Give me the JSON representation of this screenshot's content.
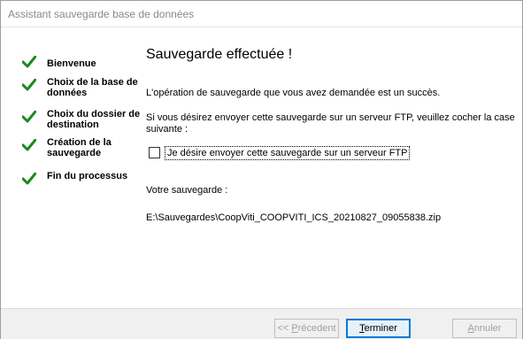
{
  "window": {
    "title": "Assistant sauvegarde base de données"
  },
  "colors": {
    "check_green": "#1a8a1a",
    "accent": "#0078d7"
  },
  "sidebar": {
    "steps": [
      {
        "label": "Bienvenue",
        "icon": "check-icon",
        "completed": true
      },
      {
        "label": "Choix de la base de données",
        "icon": "check-icon",
        "completed": true
      },
      {
        "label": "Choix du dossier de destination",
        "icon": "check-icon",
        "completed": true
      },
      {
        "label": "Création de la sauvegarde",
        "icon": "check-icon",
        "completed": true
      },
      {
        "label": "Fin du processus",
        "icon": "check-icon",
        "completed": true
      }
    ]
  },
  "main": {
    "heading": "Sauvegarde effectuée !",
    "success_message": "L'opération de sauvegarde que vous avez demandée est un succès.",
    "ftp_instruction": "Si vous désirez envoyer cette sauvegarde sur un serveur FTP,  veuillez cocher la case suivante :",
    "ftp_checkbox": {
      "label": "Je désire envoyer cette sauvegarde sur un serveur FTP",
      "checked": false
    },
    "backup_label": "Votre sauvegarde :",
    "backup_path": "E:\\Sauvegardes\\CoopViti_COOPVITI_ICS_20210827_09055838.zip"
  },
  "footer": {
    "previous": {
      "prefix": "<< ",
      "mnemonic": "P",
      "rest": "récedent",
      "enabled": false
    },
    "finish": {
      "mnemonic": "T",
      "rest": "erminer",
      "enabled": true
    },
    "cancel": {
      "mnemonic": "A",
      "rest": "nnuler",
      "enabled": false
    }
  }
}
